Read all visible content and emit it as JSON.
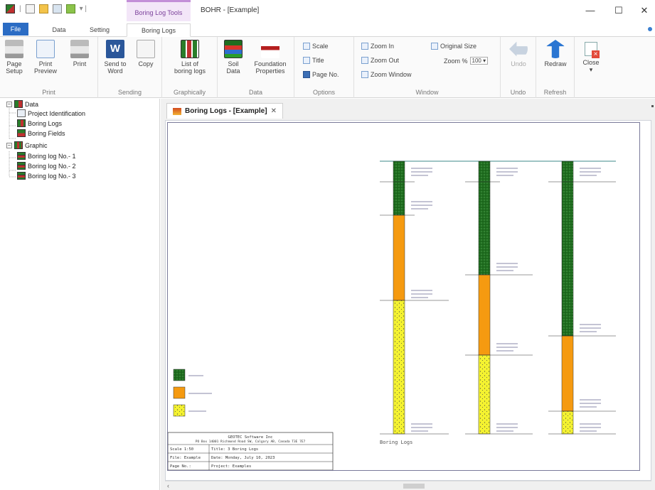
{
  "window": {
    "context_tab_title": "Boring Log Tools",
    "title": "BOHR - [Example]",
    "minimize": "—",
    "maximize": "☐",
    "close": "✕"
  },
  "ribbon_tabs": [
    "File",
    "Data",
    "Setting",
    "Boring Logs"
  ],
  "ribbon": {
    "print": {
      "label": "Print",
      "page_setup": "Page\nSetup",
      "print_preview": "Print\nPreview",
      "print": "Print"
    },
    "sending": {
      "label": "Sending",
      "send_to_word": "Send to\nWord",
      "copy": "Copy"
    },
    "graphically": {
      "label": "Graphically",
      "list_of_boring_logs": "List of\nboring logs"
    },
    "data": {
      "label": "Data",
      "soil_data": "Soil\nData",
      "foundation_properties": "Foundation\nProperties"
    },
    "options": {
      "label": "Options",
      "scale": "Scale",
      "title": "Title",
      "page_no": "Page No."
    },
    "window": {
      "label": "Window",
      "zoom_in": "Zoom In",
      "zoom_out": "Zoom Out",
      "zoom_window": "Zoom Window",
      "original_size": "Original Size",
      "zoom_pct_label": "Zoom %",
      "zoom_pct_value": "100 ▾"
    },
    "undo": {
      "label": "Undo",
      "undo": "Undo"
    },
    "refresh": {
      "label": "Refresh",
      "redraw": "Redraw"
    },
    "close": {
      "label": "Close\n▾"
    }
  },
  "tree": {
    "data": "Data",
    "project_identification": "Project Identification",
    "boring_logs": "Boring Logs",
    "boring_fields": "Boring Fields",
    "graphic": "Graphic",
    "log1": "Boring log No.- 1",
    "log2": "Boring log No.- 2",
    "log3": "Boring log No.- 3"
  },
  "doc_tab": {
    "title": "Boring Logs - [Example]",
    "close": "✕"
  },
  "drawing": {
    "caption": "Boring Logs",
    "title_block": {
      "company": "GEOTEC Software Inc",
      "address": "PO Box 14001 Richmond Road SW, Calgary AB, Canada T3E 7E7",
      "scale": "Scale 1:50",
      "title": "Title: 3 Boring Logs",
      "file": "File: Example",
      "date": "Date: Monday, July 10, 2023",
      "page": "Page No.:",
      "project": "Project: Examples"
    }
  },
  "colors": {
    "topsoil": "#1f6d1f",
    "clay": "#f59a10",
    "sand": "#f4f230",
    "accent": "#2b6cc4"
  }
}
